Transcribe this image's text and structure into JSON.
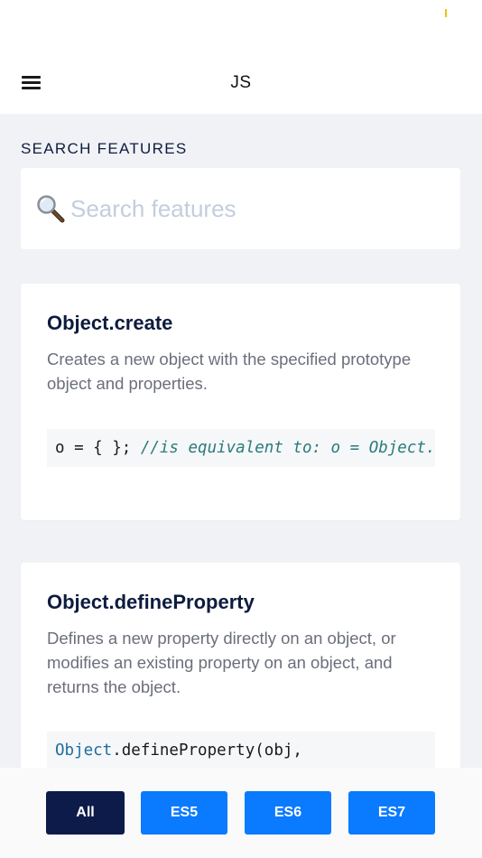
{
  "nav": {
    "title": "JS",
    "menu_icon": "hamburger-menu-icon"
  },
  "search": {
    "section_label": "SEARCH FEATURES",
    "placeholder": "Search features",
    "value": "",
    "icon": "magnifying-glass-icon"
  },
  "features": [
    {
      "title": "Object.create",
      "description": "Creates a new object with the specified prototype object and properties.",
      "code_line": "o = { }; ",
      "code_comment": "//is equivalent to: o = Object.create(Object.prototype);"
    },
    {
      "title": "Object.defineProperty",
      "description": "Defines a new property directly on an object, or modifies an existing property on an object, and returns the object.",
      "code_builtin": "Object",
      "code_line": ".defineProperty(obj,"
    }
  ],
  "filters": {
    "selected": "All",
    "buttons": [
      "All",
      "ES5",
      "ES6",
      "ES7"
    ]
  },
  "colors": {
    "accent": "#0a7aff",
    "selected": "#0d1b4a",
    "title": "#0d1b3e",
    "background": "#f1f2f6"
  }
}
